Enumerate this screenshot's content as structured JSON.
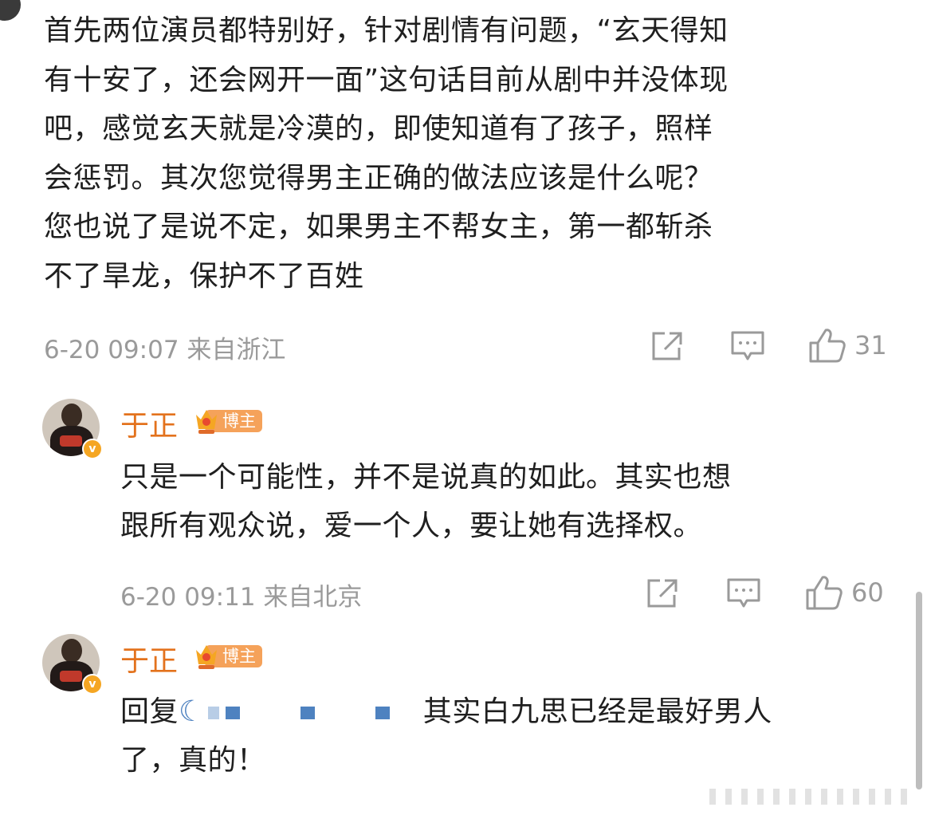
{
  "first_comment": {
    "lines": [
      "首先两位演员都特别好，针对剧情有问题，“玄天得知",
      "有十安了，还会网开一面”这句话目前从剧中并没体现",
      "吧，感觉玄天就是冷漠的，即使知道有了孩子，照样",
      "会惩罚。其次您觉得男主正确的做法应该是什么呢？",
      "您也说了是说不定，如果男主不帮女主，第一都斩杀",
      "不了旱龙，保护不了百姓"
    ],
    "meta": "6-20 09:07 来自浙江",
    "like_count": "31"
  },
  "replies": [
    {
      "username": "于正",
      "badge": "博主",
      "lines": [
        "只是一个可能性，并不是说真的如此。其实也想",
        "跟所有观众说，爱一个人，要让她有选择权。"
      ],
      "meta": "6-20 09:11 来自北京",
      "like_count": "60"
    },
    {
      "username": "于正",
      "badge": "博主",
      "reply_prefix": "回复",
      "reply_rest": "其实白九思已经是最好男人",
      "line2": "了，真的！"
    }
  ],
  "icons": {
    "share": "share-icon",
    "comment": "comment-icon",
    "like": "thumbs-up-icon",
    "verified": "verified-badge-icon",
    "crown": "crown-icon"
  },
  "colors": {
    "username": "#e3721d",
    "meta": "#9a9a9a",
    "badge": "#f5a25a",
    "verified": "#f5a623"
  }
}
